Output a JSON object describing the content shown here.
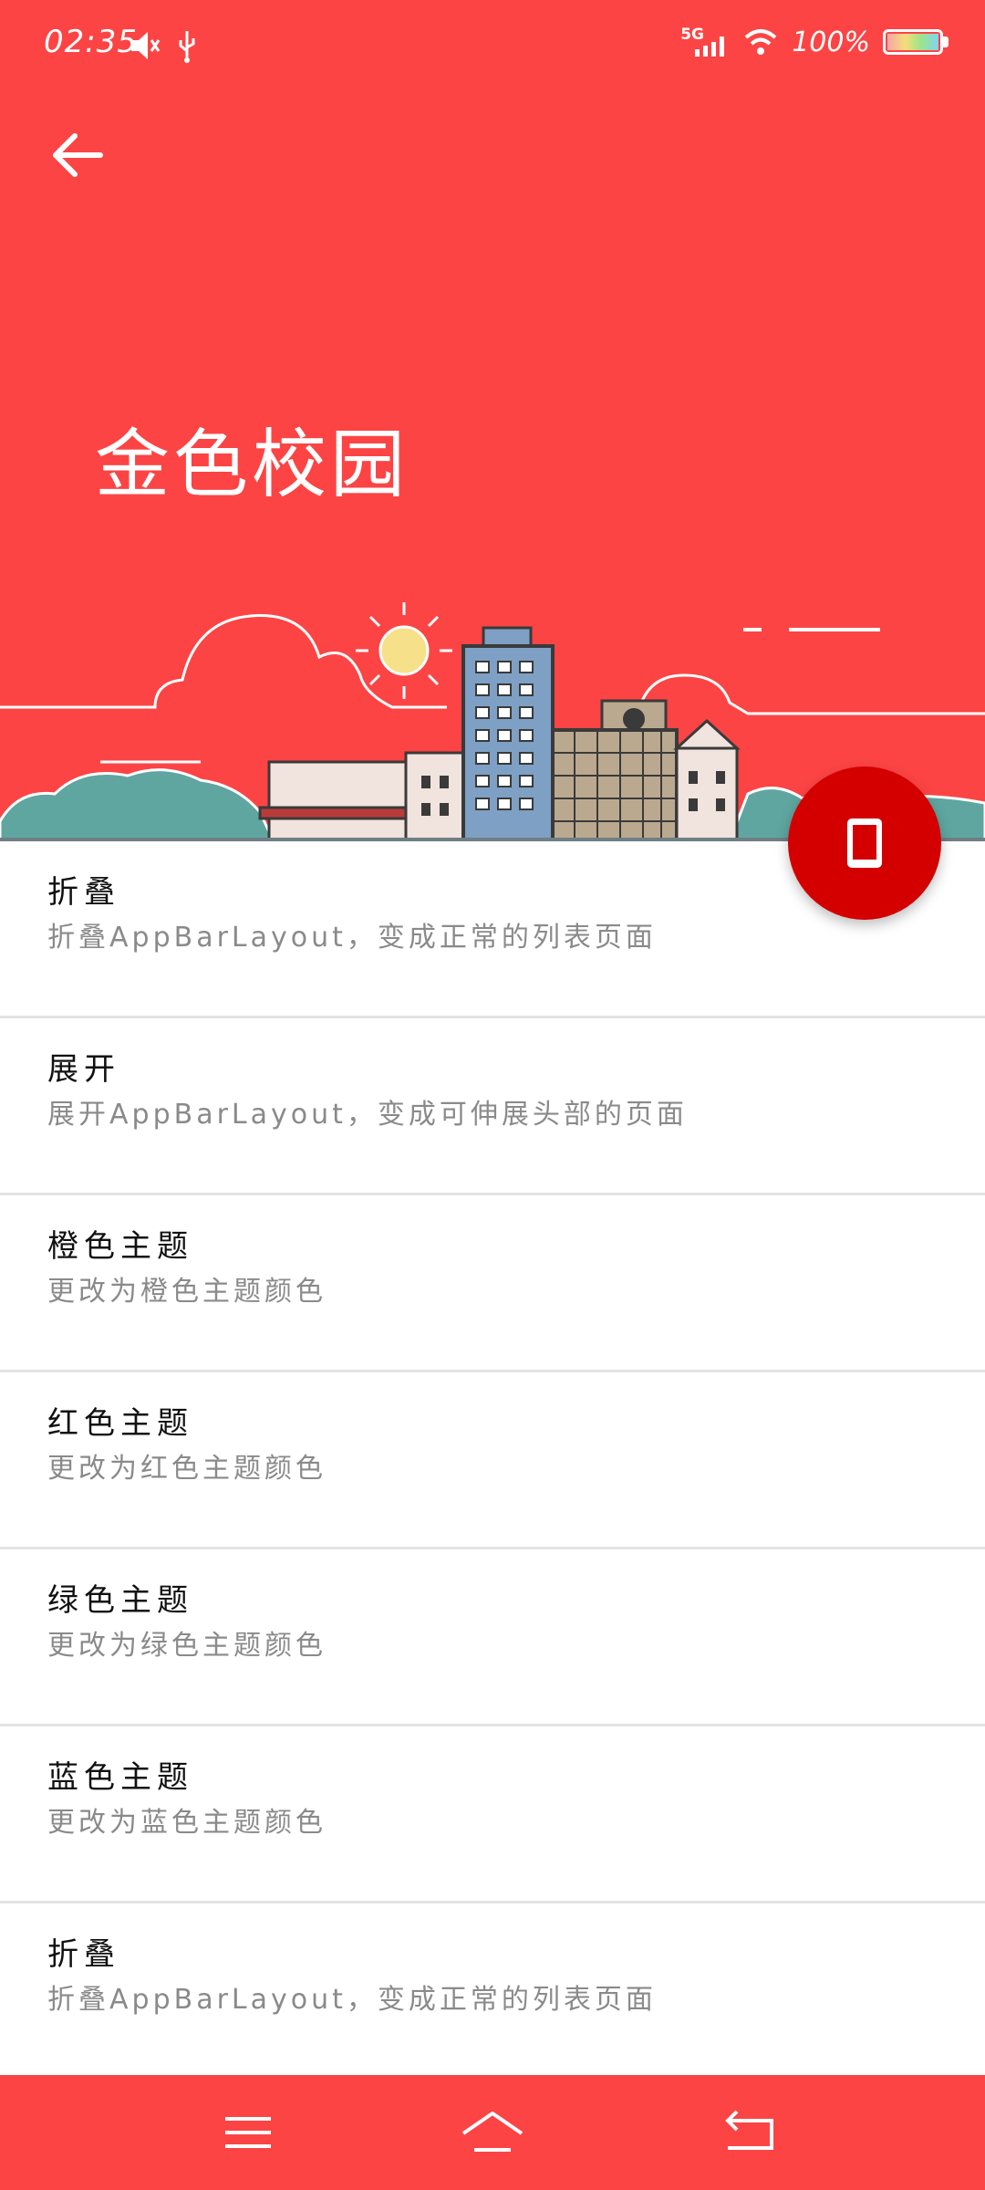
{
  "status_bar": {
    "time": "02:35",
    "network": "5G",
    "battery": "100%"
  },
  "header": {
    "title": "金色校园"
  },
  "list": {
    "items": [
      {
        "title": "折叠",
        "desc": "折叠AppBarLayout，变成正常的列表页面"
      },
      {
        "title": "展开",
        "desc": "展开AppBarLayout，变成可伸展头部的页面"
      },
      {
        "title": "橙色主题",
        "desc": "更改为橙色主题颜色"
      },
      {
        "title": "红色主题",
        "desc": "更改为红色主题颜色"
      },
      {
        "title": "绿色主题",
        "desc": "更改为绿色主题颜色"
      },
      {
        "title": "蓝色主题",
        "desc": "更改为蓝色主题颜色"
      },
      {
        "title": "折叠",
        "desc": "折叠AppBarLayout，变成正常的列表页面"
      }
    ]
  },
  "icons": {
    "back": "arrow-left-icon",
    "fab": "phone-icon",
    "nav_menu": "menu-icon",
    "nav_home": "home-icon",
    "nav_back": "back-icon"
  },
  "colors": {
    "primary": "#fc4444",
    "fab": "#d40000"
  }
}
